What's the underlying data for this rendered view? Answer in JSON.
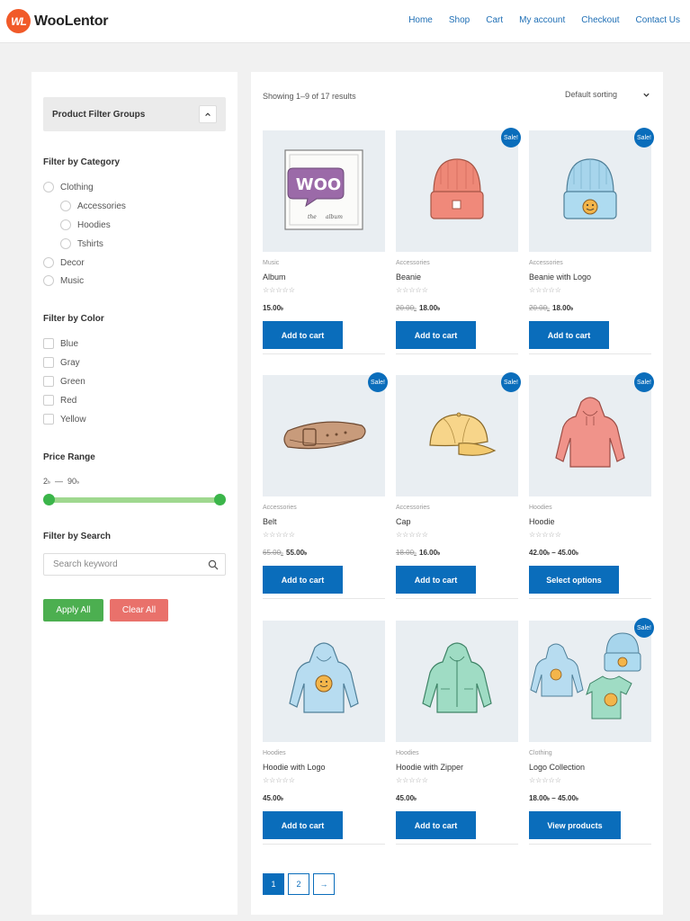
{
  "brand": {
    "logo_mark": "WL",
    "name": "WooLentor",
    "accent": "#f15a29"
  },
  "nav": [
    "Home",
    "Shop",
    "Cart",
    "My account",
    "Checkout",
    "Contact Us"
  ],
  "sidebar": {
    "filter_groups_title": "Product Filter Groups",
    "category": {
      "title": "Filter by Category",
      "items": [
        {
          "label": "Clothing",
          "level": 0
        },
        {
          "label": "Accessories",
          "level": 1
        },
        {
          "label": "Hoodies",
          "level": 1
        },
        {
          "label": "Tshirts",
          "level": 1
        },
        {
          "label": "Decor",
          "level": 0
        },
        {
          "label": "Music",
          "level": 0
        }
      ]
    },
    "color": {
      "title": "Filter by Color",
      "items": [
        "Blue",
        "Gray",
        "Green",
        "Red",
        "Yellow"
      ]
    },
    "price": {
      "title": "Price Range",
      "min": "2",
      "max": "90",
      "currency": "৳",
      "separator": "—"
    },
    "search": {
      "title": "Filter by Search",
      "placeholder": "Search keyword",
      "value": ""
    },
    "apply_label": "Apply All",
    "clear_label": "Clear All"
  },
  "shop": {
    "result_count": "Showing 1–9 of 17 results",
    "sorting": "Default sorting",
    "currency": "৳",
    "products": [
      {
        "name": "Album",
        "category": "Music",
        "sale": false,
        "old_price": "",
        "price": "15.00",
        "button": "Add to cart",
        "image": "album"
      },
      {
        "name": "Beanie",
        "category": "Accessories",
        "sale": true,
        "old_price": "20.00",
        "price": "18.00",
        "button": "Add to cart",
        "image": "beanie-orange"
      },
      {
        "name": "Beanie with Logo",
        "category": "Accessories",
        "sale": true,
        "old_price": "20.00",
        "price": "18.00",
        "button": "Add to cart",
        "image": "beanie-blue"
      },
      {
        "name": "Belt",
        "category": "Accessories",
        "sale": true,
        "old_price": "65.00",
        "price": "55.00",
        "button": "Add to cart",
        "image": "belt"
      },
      {
        "name": "Cap",
        "category": "Accessories",
        "sale": true,
        "old_price": "18.00",
        "price": "16.00",
        "button": "Add to cart",
        "image": "cap"
      },
      {
        "name": "Hoodie",
        "category": "Hoodies",
        "sale": true,
        "old_price": "",
        "price": "42.00",
        "price_max": "45.00",
        "button": "Select options",
        "image": "hoodie-red"
      },
      {
        "name": "Hoodie with Logo",
        "category": "Hoodies",
        "sale": false,
        "old_price": "",
        "price": "45.00",
        "button": "Add to cart",
        "image": "hoodie-blue"
      },
      {
        "name": "Hoodie with Zipper",
        "category": "Hoodies",
        "sale": false,
        "old_price": "",
        "price": "45.00",
        "button": "Add to cart",
        "image": "hoodie-green"
      },
      {
        "name": "Logo Collection",
        "category": "Clothing",
        "sale": true,
        "old_price": "",
        "price": "18.00",
        "price_max": "45.00",
        "button": "View products",
        "image": "collection"
      }
    ],
    "sale_label": "Sale!",
    "stars": "☆☆☆☆☆",
    "pagination": [
      "1",
      "2",
      "→"
    ]
  }
}
